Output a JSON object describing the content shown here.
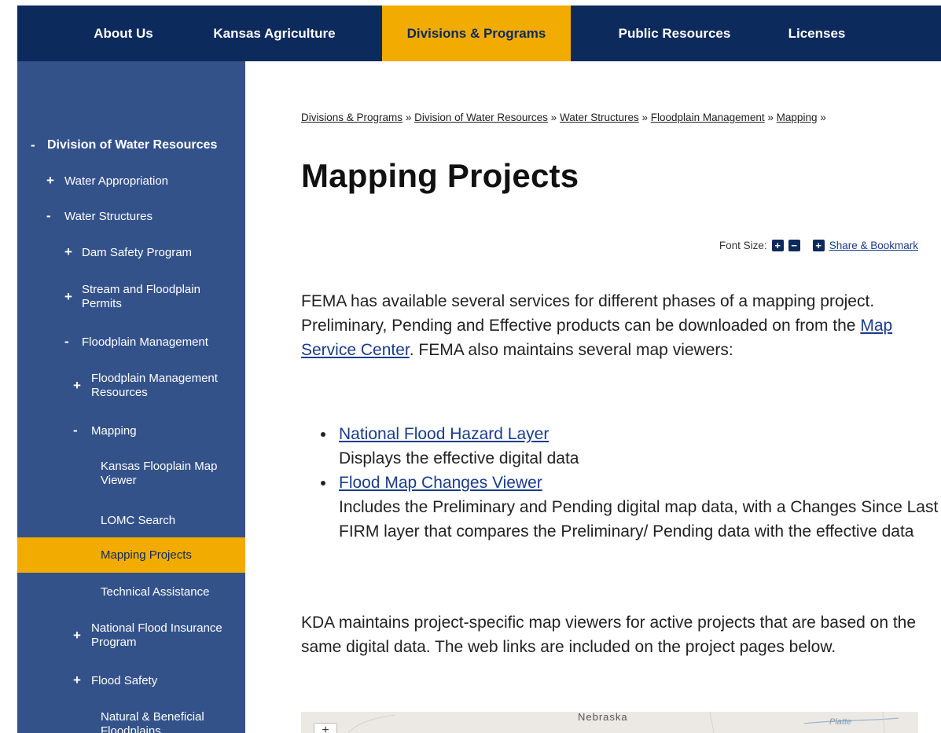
{
  "topnav": {
    "items": [
      {
        "label": "About Us"
      },
      {
        "label": "Kansas Agriculture"
      },
      {
        "label": "Divisions & Programs"
      },
      {
        "label": "Public Resources"
      },
      {
        "label": "Licenses"
      }
    ],
    "active_index": 2
  },
  "sidebar": {
    "items": [
      {
        "sign": "-",
        "label": "Division of Water Resources"
      },
      {
        "sign": "+",
        "label": "Water Appropriation"
      },
      {
        "sign": "-",
        "label": "Water Structures"
      },
      {
        "sign": "+",
        "label": "Dam Safety Program"
      },
      {
        "sign": "+",
        "label": "Stream and Floodplain Permits"
      },
      {
        "sign": "-",
        "label": "Floodplain Management"
      },
      {
        "sign": "+",
        "label": "Floodplain Management Resources"
      },
      {
        "sign": "-",
        "label": "Mapping"
      },
      {
        "sign": "",
        "label": "Kansas Flooplain Map Viewer"
      },
      {
        "sign": "",
        "label": "LOMC Search"
      },
      {
        "sign": "",
        "label": "Mapping Projects"
      },
      {
        "sign": "",
        "label": "Technical Assistance"
      },
      {
        "sign": "+",
        "label": "National Flood Insurance Program"
      },
      {
        "sign": "+",
        "label": "Flood Safety"
      },
      {
        "sign": "",
        "label": "Natural & Beneficial Floodplains"
      }
    ],
    "active_label": "Mapping Projects"
  },
  "breadcrumb": {
    "items": [
      "Divisions & Programs",
      "Division of Water Resources",
      "Water Structures",
      "Floodplain Management",
      "Mapping"
    ],
    "separator": "»"
  },
  "page": {
    "title": "Mapping Projects"
  },
  "tools": {
    "font_size_label": "Font Size:",
    "increase": "+",
    "decrease": "−",
    "share_icon": "+",
    "share_label": "Share & Bookmark"
  },
  "content": {
    "intro_before_link": "FEMA has available several services for different phases of a mapping project. Preliminary, Pending and Effective products can be downloaded on from the ",
    "intro_link": "Map Service Center",
    "intro_after_link": ". FEMA also maintains several map viewers:",
    "viewers": [
      {
        "link": "National Flood Hazard Layer",
        "desc": "Displays the effective digital data"
      },
      {
        "link": "Flood Map Changes Viewer",
        "desc": "Includes the Preliminary and Pending digital map data, with a Changes Since Last FIRM layer that compares the Preliminary/ Pending data with the effective data"
      }
    ],
    "kda_paragraph": "KDA maintains project-specific map viewers for active projects that are based on the same digital data. The web links are included on the project pages below."
  },
  "map": {
    "label_state": "Nebraska",
    "label_river": "Platte",
    "zoom_in": "+"
  },
  "colors": {
    "navy": "#0d2a5c",
    "sidebar_blue": "#34528a",
    "accent_gold": "#f2ab00",
    "link_blue": "#1a3c8c"
  }
}
